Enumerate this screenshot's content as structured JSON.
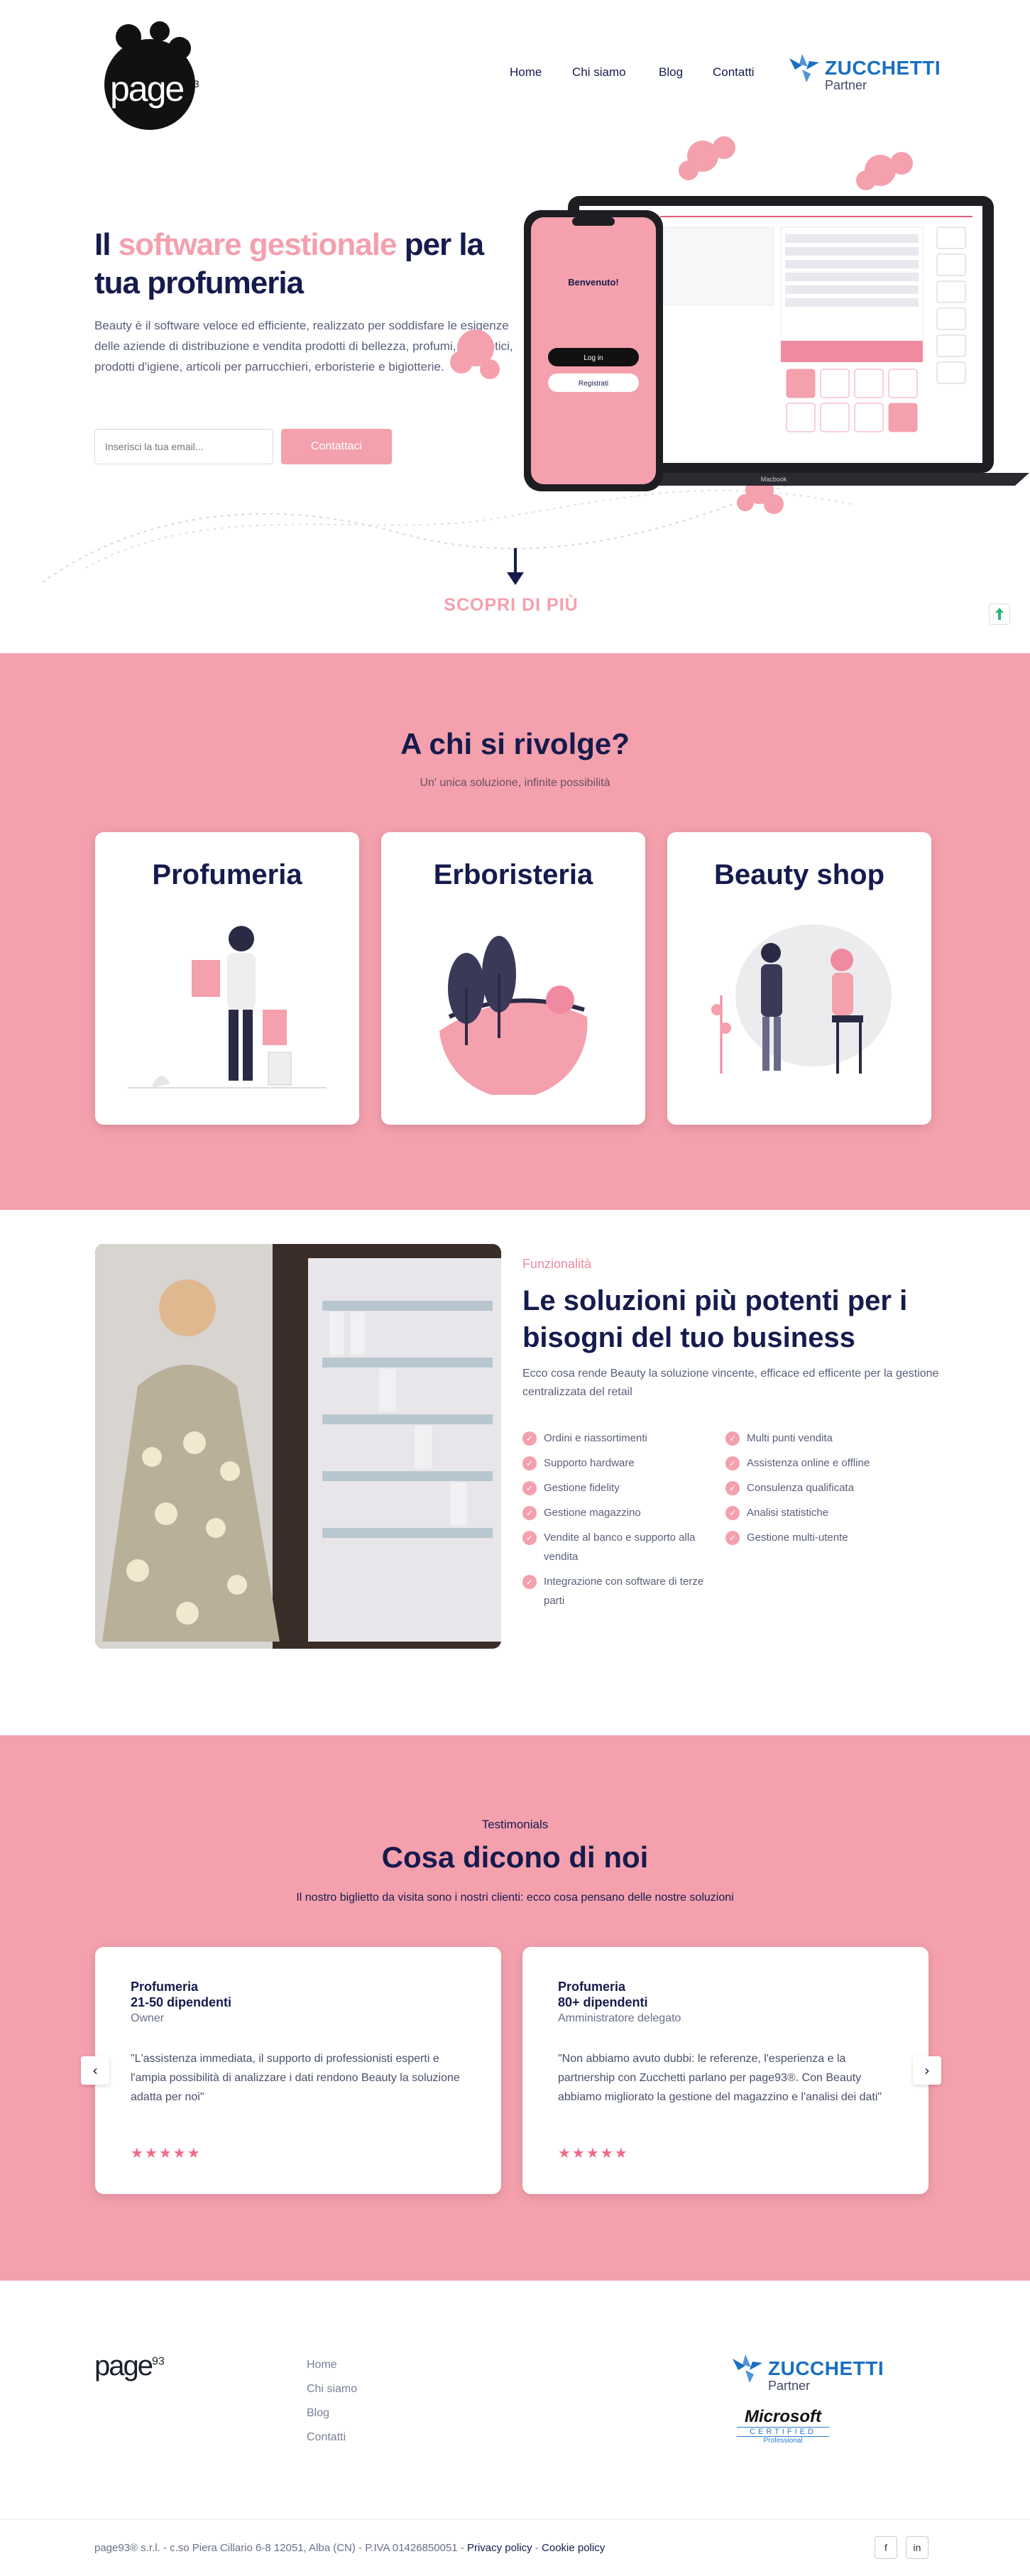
{
  "brand": {
    "logo_text": "page",
    "logo_sup": "93",
    "accent": "#f4a0ad",
    "navy": "#151b4d"
  },
  "nav": {
    "items": [
      "Home",
      "Chi siamo",
      "Blog",
      "Contatti"
    ]
  },
  "partner": {
    "name": "ZUCCHETTI",
    "sub": "Partner"
  },
  "hero": {
    "title_1": "Il ",
    "title_hl": "software gestionale",
    "title_2": " per la tua profumeria",
    "desc": "Beauty è il software veloce ed efficiente, realizzato per soddisfare le esigenze delle aziende di distribuzione e vendita prodotti di bellezza, profumi, cosmetici, prodotti d'igiene, articoli per parrucchieri, erboristerie e bigiotterie.",
    "email_placeholder": "Inserisci la tua email...",
    "cta": "Contattaci",
    "phone_welcome": "Benvenuto!",
    "phone_login": "Log in",
    "phone_register": "Registrati",
    "laptop_label": "Macbook",
    "scroll_label": "SCOPRI DI PIÙ"
  },
  "audience": {
    "title": "A chi si rivolge?",
    "subtitle": "Un' unica soluzione, infinite possibilità",
    "cards": [
      {
        "title": "Profumeria"
      },
      {
        "title": "Erboristeria"
      },
      {
        "title": "Beauty shop"
      }
    ]
  },
  "features": {
    "kicker": "Funzionalità",
    "title": "Le soluzioni più potenti per i bisogni del tuo business",
    "desc": "Ecco cosa rende Beauty la soluzione vincente, efficace ed efficente per la gestione centralizzata del retail",
    "left": [
      "Ordini e riassortimenti",
      "Supporto hardware",
      "Gestione fidelity",
      "Gestione magazzino",
      "Vendite al banco e supporto alla vendita",
      "Integrazione con software di terze parti"
    ],
    "right": [
      "Multi punti vendita",
      "Assistenza online e offline",
      "Consulenza qualificata",
      "Analisi statistiche",
      "Gestione multi-utente"
    ]
  },
  "testimonials": {
    "kicker": "Testimonials",
    "title": "Cosa dicono di noi",
    "subtitle": "Il nostro biglietto da visita sono i nostri clienti: ecco cosa pensano delle nostre soluzioni",
    "items": [
      {
        "type": "Profumeria",
        "size": "21-50 dipendenti",
        "role": "Owner",
        "quote": "\"L'assistenza immediata, il supporto di professionisti esperti e l'ampia possibilità di analizzare i dati rendono Beauty la soluzione adatta per noi\"",
        "stars": "★★★★★"
      },
      {
        "type": "Profumeria",
        "size": "80+ dipendenti",
        "role": "Amministratore delegato",
        "quote": "\"Non abbiamo avuto dubbi: le referenze, l'esperienza e la partnership con Zucchetti parlano per page93®. Con Beauty abbiamo migliorato la gestione del magazzino e l'analisi dei dati\"",
        "stars": "★★★★★"
      }
    ],
    "prev": "‹",
    "next": "›"
  },
  "footer": {
    "links": [
      "Home",
      "Chi siamo",
      "Blog",
      "Contatti"
    ],
    "ms_name": "Microsoft",
    "ms_cert": "CERTIFIED",
    "ms_pro": "Professional",
    "copyright": "page93® s.r.l. - c.so Piera Cillario 6-8 12051, Alba (CN) - P.IVA 01426850051 - ",
    "privacy": "Privacy policy",
    "sep": " - ",
    "cookie": "Cookie policy",
    "social": [
      "f",
      "in"
    ]
  }
}
